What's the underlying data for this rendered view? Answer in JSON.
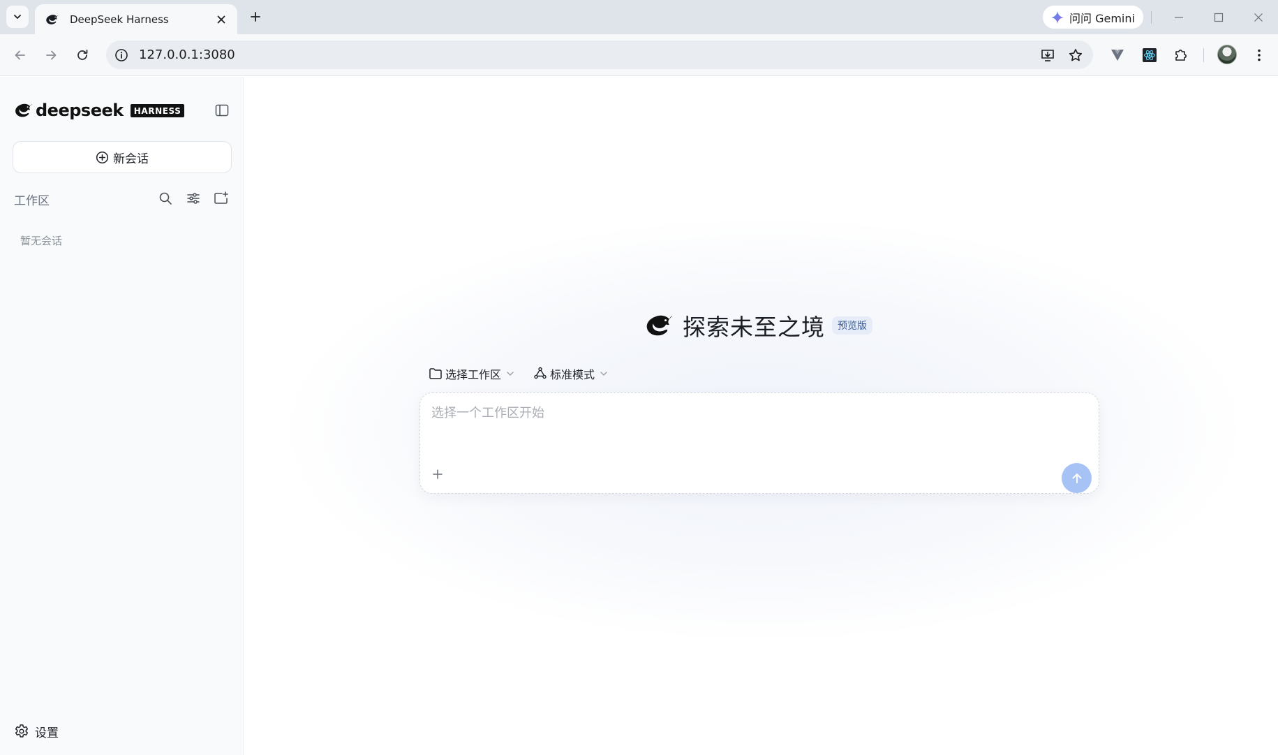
{
  "browser": {
    "tab": {
      "title": "DeepSeek Harness"
    },
    "gemini_label": "问问 Gemini",
    "address": {
      "url": "127.0.0.1:3080"
    }
  },
  "sidebar": {
    "brand_name": "deepseek",
    "brand_badge": "HARNESS",
    "new_chat_label": "新会话",
    "workspace_label": "工作区",
    "empty_label": "暂无会话",
    "settings_label": "设置"
  },
  "main": {
    "hero_title": "探索未至之境",
    "preview_badge": "预览版",
    "workspace_select_label": "选择工作区",
    "mode_select_label": "标准模式",
    "input_placeholder": "选择一个工作区开始"
  },
  "colors": {
    "accent": "#a7c2f5",
    "badge_bg": "#e6edf9",
    "badge_text": "#3a5a97",
    "sidebar_bg": "#f9fafb"
  }
}
